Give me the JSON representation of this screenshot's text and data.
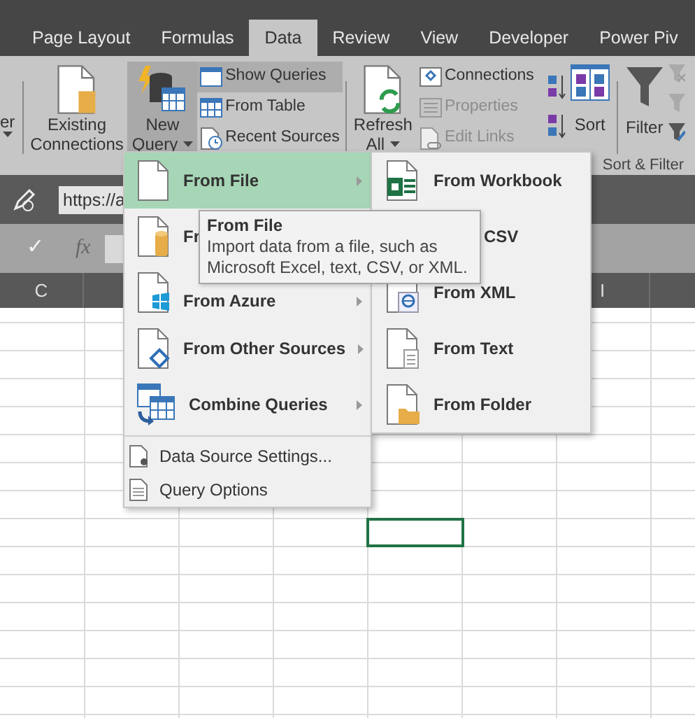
{
  "tabs": [
    {
      "label": "Page Layout",
      "selected": false
    },
    {
      "label": "Formulas",
      "selected": false
    },
    {
      "label": "Data",
      "selected": true
    },
    {
      "label": "Review",
      "selected": false
    },
    {
      "label": "View",
      "selected": false
    },
    {
      "label": "Developer",
      "selected": false
    },
    {
      "label": "Power Piv",
      "selected": false
    }
  ],
  "ribbon": {
    "cut_button": {
      "label": "er"
    },
    "existing_connections": {
      "lines": [
        "Existing",
        "Connections"
      ]
    },
    "new_query": {
      "lines": [
        "New",
        "Query"
      ],
      "pressed": true
    },
    "query_items": [
      {
        "label": "Show Queries",
        "highlighted": true
      },
      {
        "label": "From Table",
        "highlighted": false
      },
      {
        "label": "Recent Sources",
        "highlighted": false
      }
    ],
    "refresh_all": {
      "lines": [
        "Refresh",
        "All"
      ]
    },
    "connection_items": [
      {
        "label": "Connections",
        "disabled": false
      },
      {
        "label": "Properties",
        "disabled": true
      },
      {
        "label": "Edit Links",
        "disabled": true
      }
    ],
    "sort": {
      "label": "Sort"
    },
    "filter": {
      "label": "Filter"
    },
    "group_label": "Sort & Filter"
  },
  "formula_bar": {
    "name_box": "https://a",
    "enter": "✓",
    "function": "fx"
  },
  "column_headers": [
    "C",
    "I"
  ],
  "menu": {
    "items": [
      {
        "kind": "file",
        "label": "From File",
        "selected": true,
        "has_arrow": true
      },
      {
        "kind": "database",
        "label": "Fr",
        "selected": false,
        "has_arrow": false
      },
      {
        "kind": "azure",
        "label": "From Azure",
        "selected": false,
        "has_arrow": true
      },
      {
        "kind": "other",
        "label": "From Other Sources",
        "selected": false,
        "has_arrow": true
      },
      {
        "kind": "combine",
        "label": "Combine Queries",
        "selected": false,
        "has_arrow": true
      },
      {
        "kind": "settings",
        "label": "Data Source Settings...",
        "selected": false,
        "has_arrow": false
      },
      {
        "kind": "options",
        "label": "Query Options",
        "selected": false,
        "has_arrow": false
      }
    ]
  },
  "submenu": {
    "items": [
      {
        "kind": "workbook",
        "label": "From Workbook"
      },
      {
        "kind": "csv",
        "label": "CSV"
      },
      {
        "kind": "xml",
        "label": "From XML"
      },
      {
        "kind": "text",
        "label": "From Text"
      },
      {
        "kind": "folder",
        "label": "From Folder"
      }
    ]
  },
  "tooltip": {
    "title": "From File",
    "text": "Import data from a file, such as Microsoft Excel, text, CSV, or XML."
  }
}
